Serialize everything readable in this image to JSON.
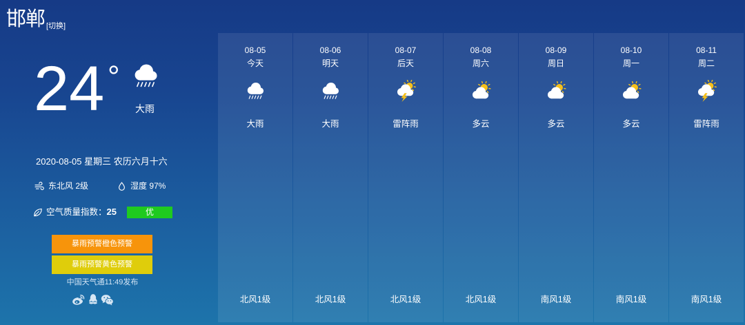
{
  "header": {
    "city": "邯郸",
    "switch_label": "[切换]"
  },
  "current": {
    "temperature": "24",
    "degree_symbol": "°",
    "icon": "heavy-rain-icon",
    "weather": "大雨",
    "date_line": "2020-08-05 星期三 农历六月十六",
    "wind_icon": "wind-icon",
    "wind": "东北风 2级",
    "humidity_icon": "humidity-drop-icon",
    "humidity": "湿度 97%",
    "aqi_icon": "leaf-icon",
    "aqi_label": "空气质量指数：",
    "aqi_value": "25",
    "aqi_level": "优",
    "aqi_color": "#1fca1f"
  },
  "alerts": [
    {
      "label": "暴雨预警橙色预警",
      "color": "#f7940b"
    },
    {
      "label": "暴雨预警黄色预警",
      "color": "#dfcd0b"
    }
  ],
  "publish_info": "中国天气通11:49发布",
  "share": [
    "weibo-icon",
    "qq-icon",
    "wechat-icon"
  ],
  "forecast": [
    {
      "date": "08-05",
      "day": "今天",
      "icon": "heavy-rain-icon",
      "weather": "大雨",
      "wind": "北风1级"
    },
    {
      "date": "08-06",
      "day": "明天",
      "icon": "heavy-rain-icon",
      "weather": "大雨",
      "wind": "北风1级"
    },
    {
      "date": "08-07",
      "day": "后天",
      "icon": "thunder-shower-icon",
      "weather": "雷阵雨",
      "wind": "北风1级"
    },
    {
      "date": "08-08",
      "day": "周六",
      "icon": "partly-cloudy-icon",
      "weather": "多云",
      "wind": "北风1级"
    },
    {
      "date": "08-09",
      "day": "周日",
      "icon": "partly-cloudy-icon",
      "weather": "多云",
      "wind": "南风1级"
    },
    {
      "date": "08-10",
      "day": "周一",
      "icon": "partly-cloudy-icon",
      "weather": "多云",
      "wind": "南风1级"
    },
    {
      "date": "08-11",
      "day": "周二",
      "icon": "thunder-shower-icon",
      "weather": "雷阵雨",
      "wind": "南风1级"
    }
  ],
  "icon_colors": {
    "sun": "#f6c01a",
    "cloud": "#ffffff",
    "line": "#ffffff",
    "share": "#d6e6f4",
    "share_detail": "#1c6ea6"
  }
}
